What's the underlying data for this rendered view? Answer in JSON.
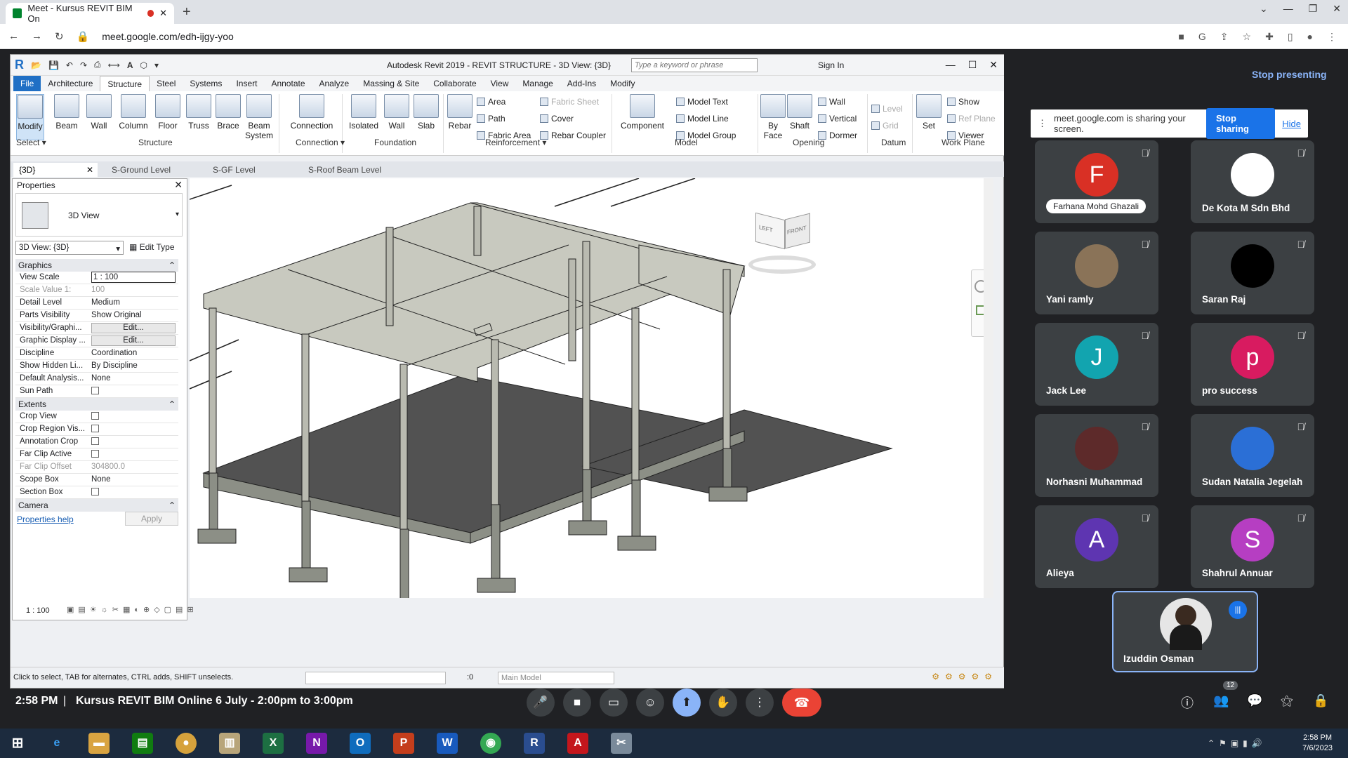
{
  "browser": {
    "tab_title": "Meet - Kursus REVIT BIM On",
    "new_tab": "+",
    "url": "meet.google.com/edh-ijgy-yoo"
  },
  "revit": {
    "title": "Autodesk Revit 2019 - REVIT STRUCTURE - 3D View: {3D}",
    "search_placeholder": "Type a keyword or phrase",
    "sign_in": "Sign In",
    "menu_tabs": [
      "File",
      "Architecture",
      "Structure",
      "Steel",
      "Systems",
      "Insert",
      "Annotate",
      "Analyze",
      "Massing & Site",
      "Collaborate",
      "View",
      "Manage",
      "Add-Ins",
      "Modify"
    ],
    "ribbon": {
      "modify": "Modify",
      "beam": "Beam",
      "wall": "Wall",
      "column": "Column",
      "floor": "Floor",
      "truss": "Truss",
      "brace": "Brace",
      "beam_system": "Beam System",
      "connection": "Connection",
      "isolated": "Isolated",
      "fwall": "Wall",
      "slab": "Slab",
      "rebar": "Rebar",
      "area": "Area",
      "path": "Path",
      "fabric_area": "Fabric  Area",
      "fabric_sheet": "Fabric  Sheet",
      "cover": "Cover",
      "rebar_coupler": "Rebar  Coupler",
      "component": "Component",
      "model_text": "Model  Text",
      "model_line": "Model  Line",
      "model_group": "Model  Group",
      "by_face": "By Face",
      "shaft": "Shaft",
      "owall": "Wall",
      "vertical": "Vertical",
      "dormer": "Dormer",
      "level": "Level",
      "grid": "Grid",
      "set": "Set",
      "show": "Show",
      "ref_plane": "Ref  Plane",
      "viewer": "Viewer",
      "groups": {
        "select": "Select",
        "structure": "Structure",
        "connection": "Connection",
        "foundation": "Foundation",
        "reinforcement": "Reinforcement",
        "model": "Model",
        "opening": "Opening",
        "datum": "Datum",
        "work_plane": "Work Plane"
      }
    },
    "view_tabs": [
      "{3D}",
      "S-Ground Level",
      "S-GF Level",
      "S-Roof Beam Level"
    ],
    "properties": {
      "title": "Properties",
      "type_name": "3D View",
      "selector": "3D View: {3D}",
      "edit_type": "Edit Type",
      "section_graphics": "Graphics",
      "section_extents": "Extents",
      "section_camera": "Camera",
      "rows_graphics": [
        {
          "k": "View Scale",
          "v": "1 : 100"
        },
        {
          "k": "Scale Value    1:",
          "v": "100"
        },
        {
          "k": "Detail Level",
          "v": "Medium"
        },
        {
          "k": "Parts Visibility",
          "v": "Show Original"
        },
        {
          "k": "Visibility/Graphi...",
          "v": "Edit..."
        },
        {
          "k": "Graphic Display ...",
          "v": "Edit..."
        },
        {
          "k": "Discipline",
          "v": "Coordination"
        },
        {
          "k": "Show Hidden Li...",
          "v": "By Discipline"
        },
        {
          "k": "Default Analysis...",
          "v": "None"
        },
        {
          "k": "Sun Path",
          "v": ""
        }
      ],
      "rows_extents": [
        {
          "k": "Crop View",
          "v": ""
        },
        {
          "k": "Crop Region Vis...",
          "v": ""
        },
        {
          "k": "Annotation Crop",
          "v": ""
        },
        {
          "k": "Far Clip Active",
          "v": ""
        },
        {
          "k": "Far Clip Offset",
          "v": "304800.0"
        },
        {
          "k": "Scope Box",
          "v": "None"
        },
        {
          "k": "Section Box",
          "v": ""
        }
      ],
      "help": "Properties help",
      "apply": "Apply"
    },
    "viewcube": {
      "left": "LEFT",
      "front": "FRONT"
    },
    "view_scale": "1 : 100",
    "status_text": "Click to select, TAB for alternates, CTRL adds, SHIFT unselects.",
    "status_zero": ":0",
    "workset": "Main Model"
  },
  "meet": {
    "stop_presenting": "Stop presenting",
    "share_msg": "meet.google.com is sharing your screen.",
    "stop_sharing": "Stop sharing",
    "hide": "Hide",
    "participants": [
      {
        "name": "Farhana Mohd Ghazali",
        "initial": "F",
        "color": "#d93025"
      },
      {
        "name": "De Kota M Sdn Bhd",
        "initial": "",
        "color": "#ffffff"
      },
      {
        "name": "Yani ramly",
        "initial": "",
        "color": "#8a7358"
      },
      {
        "name": "Saran Raj",
        "initial": "",
        "color": "#000000"
      },
      {
        "name": "Jack Lee",
        "initial": "J",
        "color": "#12a4af"
      },
      {
        "name": "pro success",
        "initial": "p",
        "color": "#d81b60"
      },
      {
        "name": "Norhasni Muhammad",
        "initial": "",
        "color": "#5d2a2a"
      },
      {
        "name": "Sudan Natalia Jegelah",
        "initial": "",
        "color": "#2b6fd6"
      },
      {
        "name": "Alieya",
        "initial": "A",
        "color": "#5e35b1"
      },
      {
        "name": "Shahrul Annuar",
        "initial": "S",
        "color": "#b63ec2"
      }
    ],
    "presenter": "Izuddin Osman",
    "time": "2:58 PM",
    "meeting_name": "Kursus REVIT BIM Online 6 July - 2:00pm to 3:00pm",
    "people_count": "12"
  },
  "taskbar": {
    "time": "2:58 PM",
    "date": "7/6/2023"
  }
}
